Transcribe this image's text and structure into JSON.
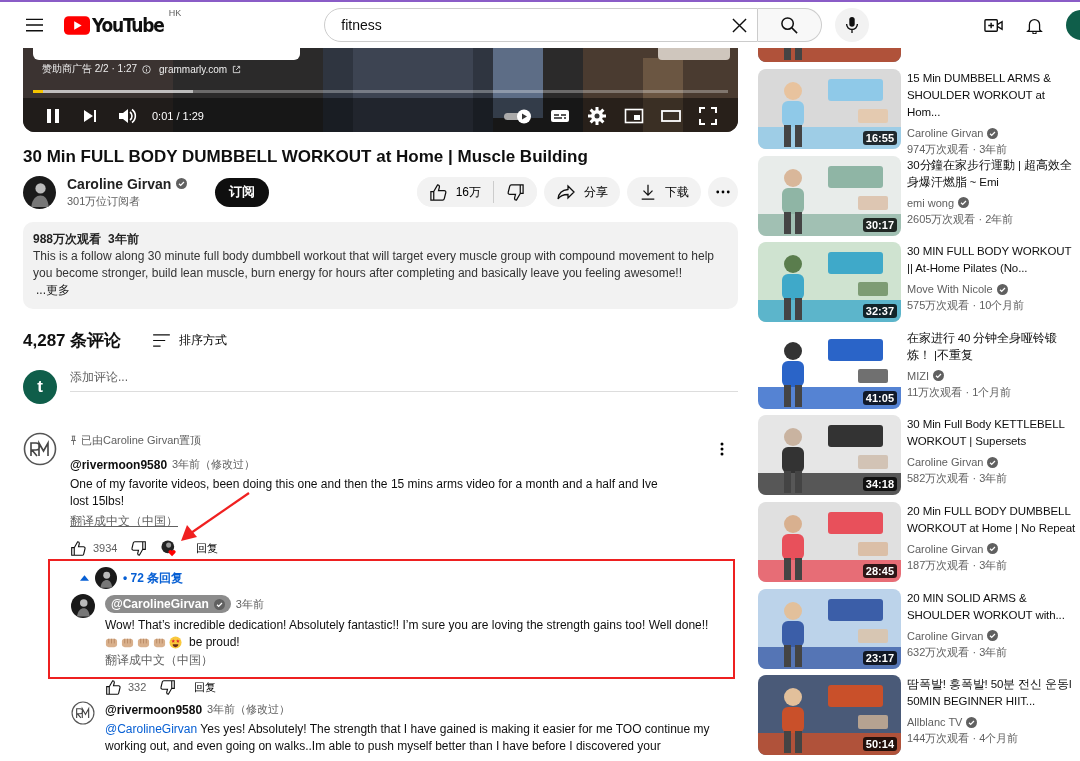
{
  "header": {
    "logo": "YouTube",
    "region": "HK",
    "search": {
      "value": "fitness"
    }
  },
  "player": {
    "ad_label": "赞助商广告 2/2 · 1:27",
    "ad_link": "grammarly.com",
    "progress": {
      "level": 0.015
    },
    "buffer": {
      "level": 0.23
    },
    "playing": true,
    "time": "0:01 / 1:29"
  },
  "video": {
    "title": "30 Min FULL BODY DUMBBELL WORKOUT at Home | Muscle Building",
    "channel": {
      "name": "Caroline Girvan",
      "verified": true,
      "subscribers": "301万位订阅者"
    },
    "subscribe": "订阅",
    "likes": "16万",
    "share": "分享",
    "download": "下载"
  },
  "description": {
    "views": "988万次观看",
    "age": "3年前",
    "text": "This is a follow along 30 minute full body dumbbell workout that will target every muscle group with compound movement to help you become stronger, build lean muscle, burn energy for hours after completing and basically leave you feeling awesome!!",
    "more": "...更多"
  },
  "comments": {
    "count": "4,287 条评论",
    "sort": "排序方式",
    "user_initial": "t",
    "add_placeholder": "添加评论...",
    "thread": {
      "pinned": "已由Caroline Girvan置顶",
      "author": "@rivermoon9580",
      "creator": false,
      "time": "3年前（修改过）",
      "text": "One of my favorite videos, been doing this one and then the 15 mins arms video for a month and a half and Ive lost 15lbs!",
      "translate": "翻译成中文（中国）",
      "translate_hovered": true,
      "likes": "3934",
      "hearted": true,
      "reply": "回复",
      "replies": {
        "label": "• 72 条回复",
        "expanded": true,
        "items": [
          {
            "author": "@CarolineGirvan",
            "creator": true,
            "verified": true,
            "time": "3年前",
            "text": "Wow! That’s incredible dedication! Absolutely fantastic!! I’m sure you are loving the strength gains too! Well done!!",
            "tail": "be proud!",
            "translate": "翻译成中文（中国）",
            "likes": "332",
            "reply": "回复"
          },
          {
            "author": "@rivermoon9580",
            "creator": false,
            "time": "3年前（修改过）",
            "mention": "@CarolineGirvan",
            "text": "Yes yes! Absolutely! The strength that I have gained is making it easier for me TOO continue my working out, and even going on walks..Im able to push myself better than I have before I discovered your"
          }
        ]
      }
    }
  },
  "sidebar": [
    {
      "title": "15 Min DUMBBELL ARMS & SHOULDER WORKOUT at Hom...",
      "channel": "Caroline Girvan",
      "verified": true,
      "meta": "974万次观看 · 3年前",
      "duration": "16:55"
    },
    {
      "title": "30分鐘在家步行運動 | 超高效全身爆汗燃脂 ~ Emi",
      "channel": "emi wong",
      "verified": true,
      "meta": "2605万次观看 · 2年前",
      "duration": "30:17"
    },
    {
      "title": "30 MIN FULL BODY WORKOUT || At-Home Pilates (No...",
      "channel": "Move With Nicole",
      "verified": true,
      "meta": "575万次观看 · 10个月前",
      "duration": "32:37"
    },
    {
      "title": "在家进行 40 分钟全身哑铃锻炼！ |不重复",
      "channel": "MIZI",
      "verified": true,
      "meta": "11万次观看 · 1个月前",
      "duration": "41:05"
    },
    {
      "title": "30 Min Full Body KETTLEBELL WORKOUT | Supersets",
      "channel": "Caroline Girvan",
      "verified": true,
      "meta": "582万次观看 · 3年前",
      "duration": "34:18"
    },
    {
      "title": "20 Min FULL BODY DUMBBELL WORKOUT at Home | No Repeat",
      "channel": "Caroline Girvan",
      "verified": true,
      "meta": "187万次观看 · 3年前",
      "duration": "28:45"
    },
    {
      "title": "20 MIN SOLID ARMS & SHOULDER WORKOUT with...",
      "channel": "Caroline Girvan",
      "verified": true,
      "meta": "632万次观看 · 3年前",
      "duration": "23:17"
    },
    {
      "title": "땀폭발! 흥폭발! 50분 전신 운동l 50MIN BEGINNER HIIT...",
      "channel": "Allblanc TV",
      "verified": true,
      "meta": "144万次观看 · 4个月前",
      "duration": "50:14"
    }
  ]
}
